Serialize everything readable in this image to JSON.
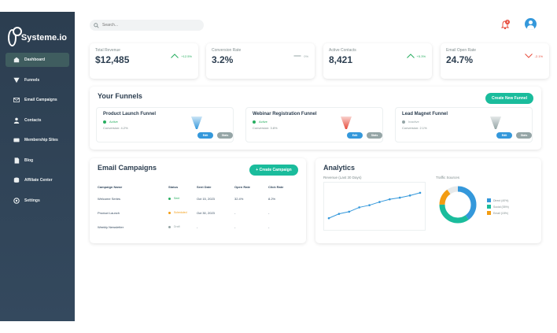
{
  "brand": {
    "name": "Systeme.io"
  },
  "nav": [
    {
      "label": "Dashboard",
      "icon": "home-icon",
      "active": true
    },
    {
      "label": "Funnels",
      "icon": "funnel-icon",
      "active": false
    },
    {
      "label": "Email Campaigns",
      "icon": "envelope-icon",
      "active": false
    },
    {
      "label": "Contacts",
      "icon": "user-icon",
      "active": false
    },
    {
      "label": "Membership Sites",
      "icon": "membership-icon",
      "active": false
    },
    {
      "label": "Blog",
      "icon": "document-icon",
      "active": false
    },
    {
      "label": "Affiliate Center",
      "icon": "database-icon",
      "active": false
    },
    {
      "label": "Settings",
      "icon": "settings-icon",
      "active": false
    }
  ],
  "search": {
    "placeholder": "Search..."
  },
  "notifications": {
    "count": "3"
  },
  "metrics": [
    {
      "label": "Total Revenue",
      "value": "$12,485",
      "trend": "+12.5%",
      "direction": "up"
    },
    {
      "label": "Conversion Rate",
      "value": "3.2%",
      "trend": "0%",
      "direction": "flat"
    },
    {
      "label": "Active Contacts",
      "value": "8,421",
      "trend": "+5.3%",
      "direction": "up"
    },
    {
      "label": "Email Open Rate",
      "value": "24.7%",
      "trend": "-2.1%",
      "direction": "down"
    }
  ],
  "funnels": {
    "title": "Your Funnels",
    "create_label": "Create New Funnel",
    "items": [
      {
        "name": "Product Launch Funnel",
        "status": "Active",
        "conversion": "Conversion: 4.2%",
        "color": "#3498db",
        "status_color": "#27ae60",
        "edit": "Edit",
        "stats": "Stats"
      },
      {
        "name": "Webinar Registration Funnel",
        "status": "Active",
        "conversion": "Conversion: 3.8%",
        "color": "#e74c3c",
        "status_color": "#27ae60",
        "edit": "Edit",
        "stats": "Stats"
      },
      {
        "name": "Lead Magnet Funnel",
        "status": "Inactive",
        "conversion": "Conversion: 2.1%",
        "color": "#95a5a6",
        "status_color": "#95a5a6",
        "edit": "Edit",
        "stats": "Stats"
      }
    ]
  },
  "campaigns": {
    "title": "Email Campaigns",
    "create_label": "+ Create Campaign",
    "columns": [
      "Campaign Name",
      "Status",
      "Sent Date",
      "Open Rate",
      "Click Rate"
    ],
    "rows": [
      {
        "name": "Welcome Series",
        "status": "Sent",
        "status_color": "#27ae60",
        "date": "Oct 15, 2023",
        "open": "32.4%",
        "click": "8.2%"
      },
      {
        "name": "Product Launch",
        "status": "Scheduled",
        "status_color": "#f39c12",
        "date": "Oct 30, 2023",
        "open": "-",
        "click": "-"
      },
      {
        "name": "Weekly Newsletter",
        "status": "Draft",
        "status_color": "#95a5a6",
        "date": "-",
        "open": "-",
        "click": "-"
      }
    ]
  },
  "analytics": {
    "title": "Analytics",
    "revenue_label": "Revenue (Last 30 Days)",
    "traffic_label": "Traffic Sources"
  },
  "chart_data": [
    {
      "type": "line",
      "title": "Revenue (Last 30 Days)",
      "x": [
        1,
        2,
        3,
        4,
        5,
        6,
        7,
        8,
        9,
        10
      ],
      "values": [
        10,
        18,
        22,
        30,
        34,
        40,
        45,
        48,
        52,
        57
      ],
      "ylim": [
        0,
        70
      ],
      "color": "#3498db"
    },
    {
      "type": "pie",
      "title": "Traffic Sources",
      "categories": [
        "Direct (40%)",
        "Social (35%)",
        "Email (15%)"
      ],
      "values": [
        40,
        35,
        15
      ],
      "colors": [
        "#3498db",
        "#1abc9c",
        "#f39c12"
      ],
      "remainder_color": "#e6e9ea"
    }
  ]
}
